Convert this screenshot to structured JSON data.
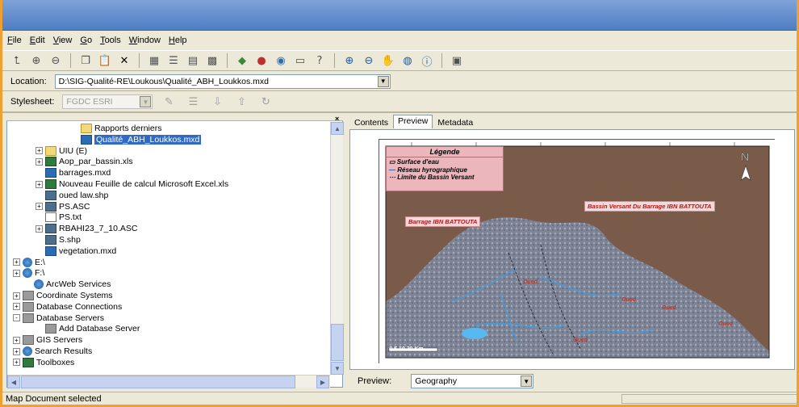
{
  "menu": [
    "File",
    "Edit",
    "View",
    "Go",
    "Tools",
    "Window",
    "Help"
  ],
  "toolbar_icons": [
    "up-folder-icon",
    "connect-icon",
    "disconnect-icon",
    "copy-icon",
    "paste-icon",
    "delete-icon",
    "large-icons-icon",
    "list-icon",
    "details-icon",
    "thumbnails-icon",
    "launch-arcmap-icon",
    "arctoolbox-icon",
    "arcmap-icon",
    "command-line-icon",
    "whats-this-icon",
    "zoom-in-icon",
    "zoom-out-icon",
    "pan-icon",
    "full-extent-icon",
    "identify-icon",
    "create-thumbnail-icon"
  ],
  "location": {
    "label": "Location:",
    "value": "D:\\SIG-Qualité-RE\\Loukous\\Qualité_ABH_Loukkos.mxd"
  },
  "stylesheet": {
    "label": "Stylesheet:",
    "value": "FGDC ESRI"
  },
  "tree": [
    {
      "label": "Rapports derniers",
      "icon": "folder",
      "indent": 80,
      "pm": ""
    },
    {
      "label": "Qualité_ABH_Loukkos.mxd",
      "icon": "mxd",
      "indent": 80,
      "pm": "",
      "selected": true
    },
    {
      "label": "UIU (E)",
      "icon": "folder",
      "indent": 36,
      "pm": "+"
    },
    {
      "label": "Aop_par_bassin.xls",
      "icon": "xls",
      "indent": 36,
      "pm": "+"
    },
    {
      "label": "barrages.mxd",
      "icon": "mxd",
      "indent": 36,
      "pm": ""
    },
    {
      "label": "Nouveau Feuille de calcul Microsoft Excel.xls",
      "icon": "xls",
      "indent": 36,
      "pm": "+"
    },
    {
      "label": "oued law.shp",
      "icon": "ras",
      "indent": 36,
      "pm": ""
    },
    {
      "label": "PS.ASC",
      "icon": "ras",
      "indent": 36,
      "pm": "+"
    },
    {
      "label": "PS.txt",
      "icon": "doc",
      "indent": 36,
      "pm": ""
    },
    {
      "label": "RBAHI23_7_10.ASC",
      "icon": "ras",
      "indent": 36,
      "pm": "+"
    },
    {
      "label": "S.shp",
      "icon": "ras",
      "indent": 36,
      "pm": ""
    },
    {
      "label": "vegetation.mxd",
      "icon": "mxd",
      "indent": 36,
      "pm": ""
    },
    {
      "label": "E:\\",
      "icon": "glob",
      "indent": 8,
      "pm": "+"
    },
    {
      "label": "F:\\",
      "icon": "glob",
      "indent": 8,
      "pm": "+"
    },
    {
      "label": "ArcWeb Services",
      "icon": "glob",
      "indent": 22,
      "pm": ""
    },
    {
      "label": "Coordinate Systems",
      "icon": "gray",
      "indent": 8,
      "pm": "+"
    },
    {
      "label": "Database Connections",
      "icon": "gray",
      "indent": 8,
      "pm": "+"
    },
    {
      "label": "Database Servers",
      "icon": "gray",
      "indent": 8,
      "pm": "-"
    },
    {
      "label": "Add Database Server",
      "icon": "gray",
      "indent": 36,
      "pm": ""
    },
    {
      "label": "GIS Servers",
      "icon": "gray",
      "indent": 8,
      "pm": "+"
    },
    {
      "label": "Search Results",
      "icon": "glob",
      "indent": 8,
      "pm": "+"
    },
    {
      "label": "Toolboxes",
      "icon": "xls",
      "indent": 8,
      "pm": "+"
    }
  ],
  "tabs": [
    "Contents",
    "Preview",
    "Metadata"
  ],
  "active_tab": "Preview",
  "map": {
    "legend_title": "Légende",
    "legend_items": [
      "Surface d'eau",
      "Réseau hyrographique",
      "Limite du Bassin Versant"
    ],
    "label_watershed": "Bassin Versant Du Barrage IBN BATTOUTA",
    "label_dam": "Barrage IBN BATTOUTA",
    "scale_text": "0   5   10      20 Km"
  },
  "preview": {
    "label": "Preview:",
    "value": "Geography"
  },
  "status": "Map Document selected",
  "colors": {
    "selection": "#316ac5",
    "chrome": "#ece9d8",
    "title": "#5a86c8",
    "water": "#7a5a48"
  }
}
